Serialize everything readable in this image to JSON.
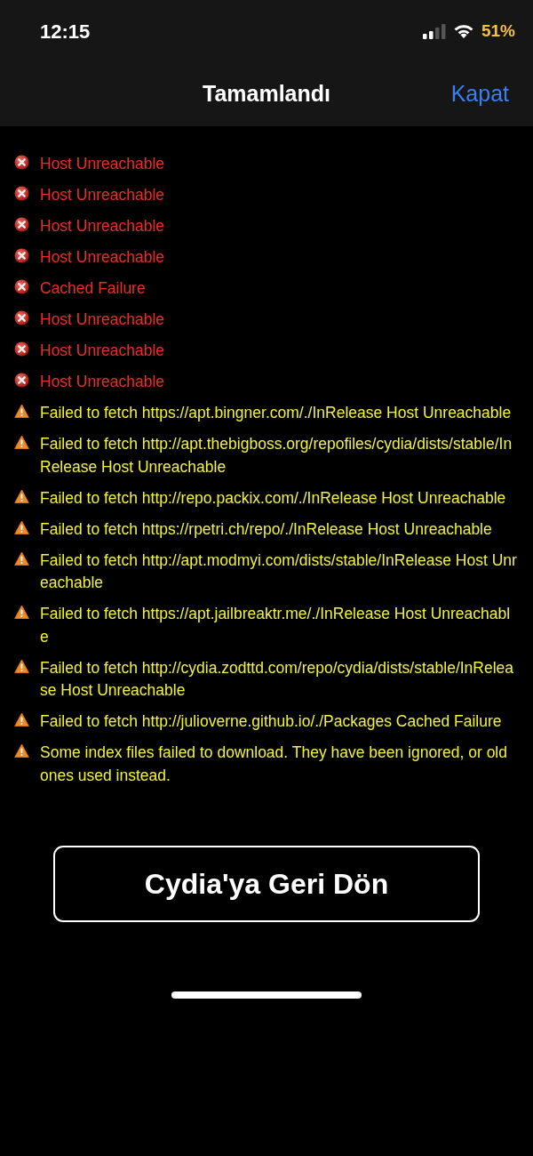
{
  "status_bar": {
    "time": "12:15",
    "battery": "51%"
  },
  "nav": {
    "title": "Tamamlandı",
    "close": "Kapat"
  },
  "messages": [
    {
      "kind": "error",
      "text": "Host Unreachable"
    },
    {
      "kind": "error",
      "text": "Host Unreachable"
    },
    {
      "kind": "error",
      "text": "Host Unreachable"
    },
    {
      "kind": "error",
      "text": "Host Unreachable"
    },
    {
      "kind": "error",
      "text": "Cached Failure"
    },
    {
      "kind": "error",
      "text": "Host Unreachable"
    },
    {
      "kind": "error",
      "text": "Host Unreachable"
    },
    {
      "kind": "error",
      "text": "Host Unreachable"
    },
    {
      "kind": "warning",
      "text": "Failed to fetch https://apt.bingner.com/./InRelease Host Unreachable"
    },
    {
      "kind": "warning",
      "text": "Failed to fetch http://apt.thebigboss.org/repofiles/cydia/dists/stable/InRelease Host Unreachable"
    },
    {
      "kind": "warning",
      "text": "Failed to fetch http://repo.packix.com/./InRelease Host Unreachable"
    },
    {
      "kind": "warning",
      "text": "Failed to fetch https://rpetri.ch/repo/./InRelease Host Unreachable"
    },
    {
      "kind": "warning",
      "text": "Failed to fetch http://apt.modmyi.com/dists/stable/InRelease Host Unreachable"
    },
    {
      "kind": "warning",
      "text": "Failed to fetch https://apt.jailbreaktr.me/./InRelease Host Unreachable"
    },
    {
      "kind": "warning",
      "text": "Failed to fetch http://cydia.zodttd.com/repo/cydia/dists/stable/InRelease Host Unreachable"
    },
    {
      "kind": "warning",
      "text": "Failed to fetch http://julioverne.github.io/./Packages Cached Failure"
    },
    {
      "kind": "warning",
      "text": "Some index files failed to download. They have been ignored, or old ones used instead."
    }
  ],
  "return_button": "Cydia'ya Geri Dön"
}
